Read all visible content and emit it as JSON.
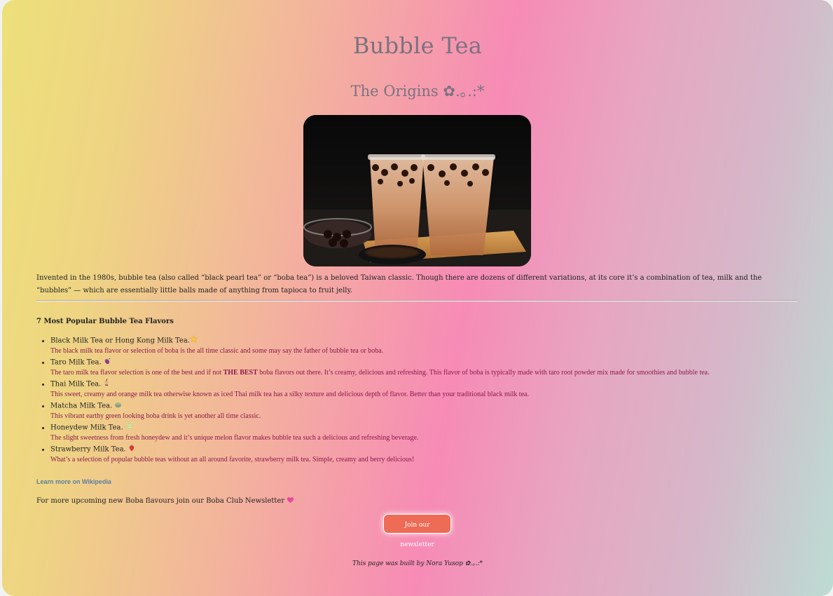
{
  "title": "Bubble Tea",
  "subtitle": "The Origins ✿.｡.:*",
  "image_alt": "Two cups of bubble milk tea with tapioca pearls",
  "intro": "Invented in the 1980s, bubble tea (also called “black pearl tea” or “boba tea”) is a beloved Taiwan classic. Though there are dozens of different variations, at its core it’s a combination of tea, milk and the “bubbles” — which are essentially little balls made of anything from tapioca to fruit jelly.",
  "flavors_title": "7 Most Popular Bubble Tea Flavors",
  "flavors": [
    {
      "name": "Black Milk Tea or Hong Kong Milk Tea.",
      "icon": "star-icon",
      "desc": "The black milk tea flavor or selection of boba is the all time classic and some may say the father of bubble tea or boba."
    },
    {
      "name": "Taro Milk Tea.",
      "icon": "eggplant-icon",
      "desc_before": "The taro milk tea flavor selection is one of the best and if not ",
      "desc_bold": "THE BEST",
      "desc_after": " boba flavors out there. It’s creamy, delicious and refreshing. This flavor of boba is typically made with taro root powder mix made for smoothies and bubble tea."
    },
    {
      "name": "Thai Milk Tea.",
      "icon": "bubble-tea-icon",
      "desc": "This sweet, creamy and orange milk tea otherwise known as iced Thai milk tea has a silky texture and delicious depth of flavor. Better than your traditional black milk tea."
    },
    {
      "name": "Matcha Milk Tea.",
      "icon": "matcha-icon",
      "desc": "This vibrant earthy green looking boba drink is yet another all time classic."
    },
    {
      "name": "Honeydew Milk Tea.",
      "icon": "melon-icon",
      "desc": "The slight sweetness from fresh honeydew and it’s unique melon flavor makes bubble tea such a delicious and refreshing beverage."
    },
    {
      "name": "Strawberry Milk Tea.",
      "icon": "strawberry-icon",
      "desc": "What’s a selection of popular bubble teas without an all around favorite, strawberry milk tea. Simple, creamy and berry delicious!"
    }
  ],
  "wiki_link": "Learn more on Wikipedia",
  "newsletter_text": "For more upcoming new Boba flavours join our Boba Club Newsletter",
  "newsletter_button": "Join our newsletter",
  "footer": "This page was built by Nora Yusop ✿.｡.:*",
  "colors": {
    "button": "#ee6b55",
    "heading": "#7a7280",
    "description": "#8a1a4a",
    "link": "#5b7fa0"
  }
}
